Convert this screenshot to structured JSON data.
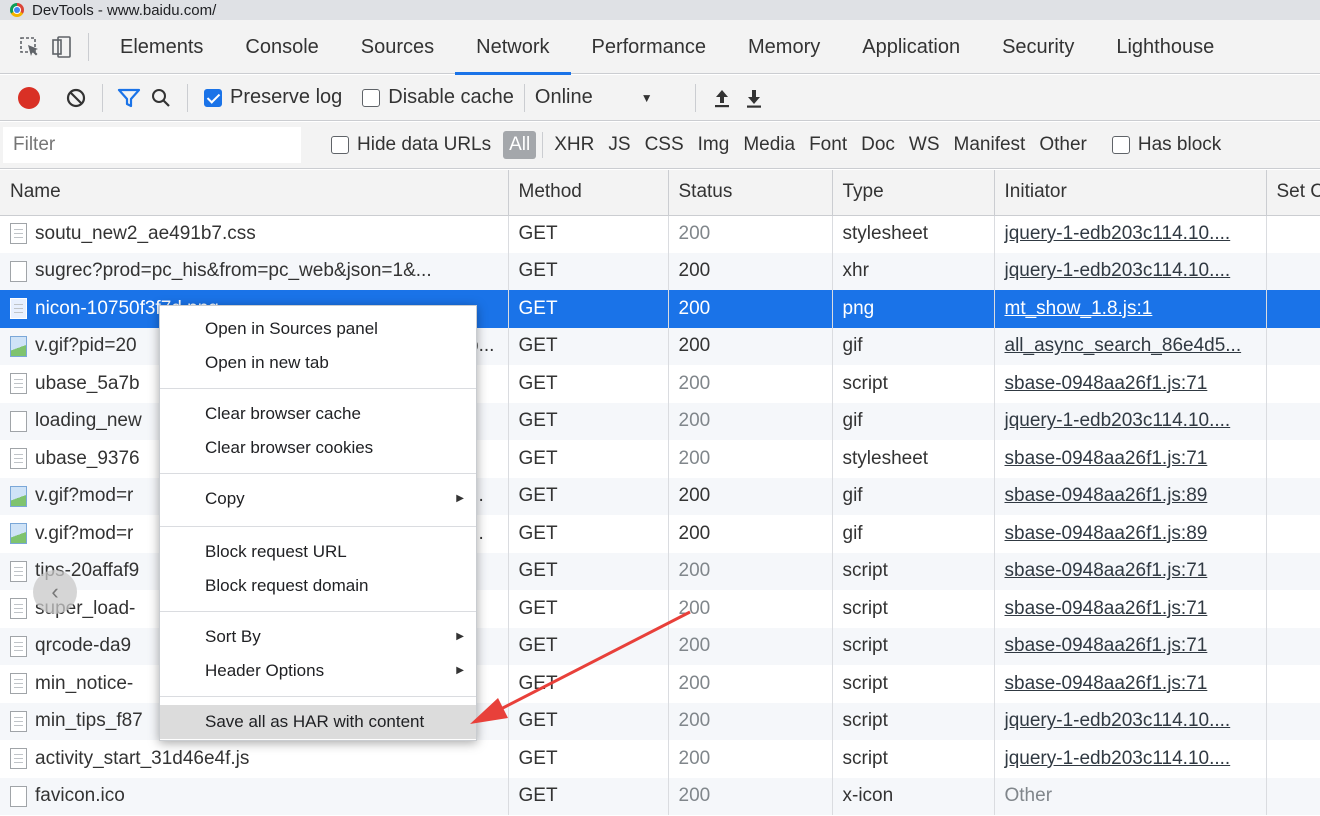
{
  "window": {
    "title": "DevTools - www.baidu.com/"
  },
  "tabs": [
    "Elements",
    "Console",
    "Sources",
    "Network",
    "Performance",
    "Memory",
    "Application",
    "Security",
    "Lighthouse"
  ],
  "active_tab": "Network",
  "toolbar": {
    "preserve_log": "Preserve log",
    "disable_cache": "Disable cache",
    "throttle": "Online"
  },
  "filterbar": {
    "filter_placeholder": "Filter",
    "hide_data_urls": "Hide data URLs",
    "types": [
      "All",
      "XHR",
      "JS",
      "CSS",
      "Img",
      "Media",
      "Font",
      "Doc",
      "WS",
      "Manifest",
      "Other"
    ],
    "has_blocked": "Has block"
  },
  "columns": [
    "Name",
    "Method",
    "Status",
    "Type",
    "Initiator",
    "Set C"
  ],
  "rows": [
    {
      "name": "soutu_new2_ae491b7.css",
      "method": "GET",
      "status": "200",
      "type": "stylesheet",
      "initiator": "jquery-1-edb203c114.10...."
    },
    {
      "name": "sugrec?prod=pc_his&from=pc_web&json=1&...",
      "method": "GET",
      "status": "200",
      "type": "xhr",
      "initiator": "jquery-1-edb203c114.10...."
    },
    {
      "name": "nicon-10750f3f7d.png",
      "method": "GET",
      "status": "200",
      "type": "png",
      "initiator": "mt_show_1.8.js:1"
    },
    {
      "name": "v.gif?pid=20",
      "name_tail": "b...",
      "method": "GET",
      "status": "200",
      "type": "gif",
      "initiator": "all_async_search_86e4d5..."
    },
    {
      "name": "ubase_5a7b",
      "method": "GET",
      "status": "200",
      "type": "script",
      "initiator": "sbase-0948aa26f1.js:71"
    },
    {
      "name": "loading_new",
      "method": "GET",
      "status": "200",
      "type": "gif",
      "initiator": "jquery-1-edb203c114.10...."
    },
    {
      "name": "ubase_9376",
      "method": "GET",
      "status": "200",
      "type": "stylesheet",
      "initiator": "sbase-0948aa26f1.js:71"
    },
    {
      "name": "v.gif?mod=r",
      "name_tail": "...",
      "method": "GET",
      "status": "200",
      "type": "gif",
      "initiator": "sbase-0948aa26f1.js:89"
    },
    {
      "name": "v.gif?mod=r",
      "name_tail": "...",
      "method": "GET",
      "status": "200",
      "type": "gif",
      "initiator": "sbase-0948aa26f1.js:89"
    },
    {
      "name": "tips-20affaf9",
      "method": "GET",
      "status": "200",
      "type": "script",
      "initiator": "sbase-0948aa26f1.js:71"
    },
    {
      "name": "super_load-",
      "method": "GET",
      "status": "200",
      "type": "script",
      "initiator": "sbase-0948aa26f1.js:71"
    },
    {
      "name": "qrcode-da9",
      "method": "GET",
      "status": "200",
      "type": "script",
      "initiator": "sbase-0948aa26f1.js:71"
    },
    {
      "name": "min_notice-",
      "method": "GET",
      "status": "200",
      "type": "script",
      "initiator": "sbase-0948aa26f1.js:71"
    },
    {
      "name": "min_tips_f87",
      "method": "GET",
      "status": "200",
      "type": "script",
      "initiator": "jquery-1-edb203c114.10...."
    },
    {
      "name": "activity_start_31d46e4f.js",
      "method": "GET",
      "status": "200",
      "type": "script",
      "initiator": "jquery-1-edb203c114.10...."
    },
    {
      "name": "favicon.ico",
      "method": "GET",
      "status": "200",
      "type": "x-icon",
      "initiator": "Other"
    }
  ],
  "context_menu": {
    "group1": [
      "Open in Sources panel",
      "Open in new tab"
    ],
    "group2": [
      "Clear browser cache",
      "Clear browser cookies"
    ],
    "group3": [
      "Copy"
    ],
    "group4": [
      "Block request URL",
      "Block request domain"
    ],
    "group5": [
      "Sort By",
      "Header Options"
    ],
    "group6": [
      "Save all as HAR with content"
    ]
  },
  "colors": {
    "accent": "#1a73e8",
    "record": "#d93025",
    "arrow": "#e8403a"
  }
}
